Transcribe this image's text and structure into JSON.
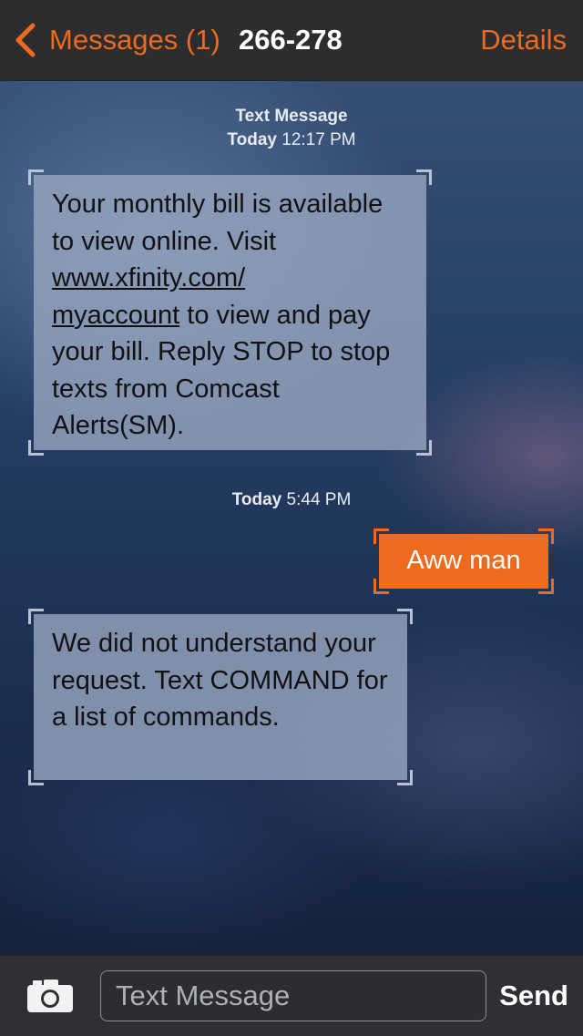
{
  "nav": {
    "back_label": "Messages (1)",
    "title": "266-278",
    "details_label": "Details"
  },
  "thread": {
    "header_type": "Text Message",
    "stamp1_day": "Today",
    "stamp1_time": "12:17 PM",
    "msg1": {
      "before_link": "Your monthly bill is available to view online. Visit ",
      "link_line1": "www.xfinity.com/",
      "link_line2": "myaccount",
      "after_link": " to view and pay your bill. Reply STOP to stop texts from Comcast Alerts(SM)."
    },
    "stamp2_day": "Today",
    "stamp2_time": "5:44 PM",
    "msg2": "Aww man",
    "msg3": "We did not understand your request. Text COMMAND for a list of commands."
  },
  "composer": {
    "placeholder": "Text Message",
    "send_label": "Send",
    "camera_icon": "camera-icon"
  },
  "colors": {
    "accent": "#ee6a1e",
    "navbar": "#2d2d2f"
  }
}
